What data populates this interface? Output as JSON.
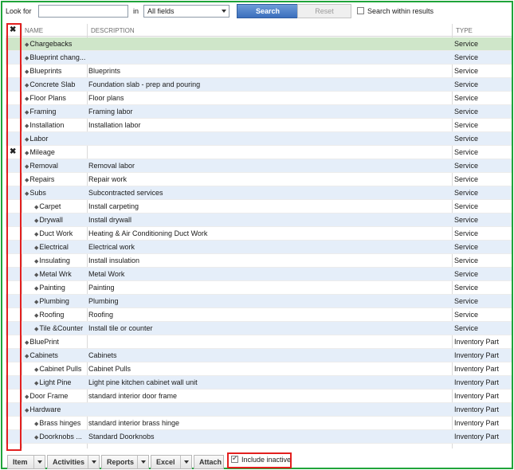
{
  "search": {
    "look_for_label": "Look for",
    "look_for_value": "",
    "in_label": "in",
    "field_selected": "All fields",
    "search_button": "Search",
    "reset_button": "Reset",
    "within_results_label": "Search within results"
  },
  "columns": {
    "active": "✖",
    "name": "NAME",
    "description": "DESCRIPTION",
    "type": "TYPE"
  },
  "items": [
    {
      "name": "Chargebacks",
      "description": "",
      "type": "Service",
      "indent": 0,
      "inactive": false
    },
    {
      "name": "Blueprint chang...",
      "description": "",
      "type": "Service",
      "indent": 0,
      "inactive": false
    },
    {
      "name": "Blueprints",
      "description": "Blueprints",
      "type": "Service",
      "indent": 0,
      "inactive": false
    },
    {
      "name": "Concrete Slab",
      "description": "Foundation slab - prep and pouring",
      "type": "Service",
      "indent": 0,
      "inactive": false
    },
    {
      "name": "Floor Plans",
      "description": "Floor plans",
      "type": "Service",
      "indent": 0,
      "inactive": false
    },
    {
      "name": "Framing",
      "description": "Framing labor",
      "type": "Service",
      "indent": 0,
      "inactive": false
    },
    {
      "name": "Installation",
      "description": "Installation labor",
      "type": "Service",
      "indent": 0,
      "inactive": false
    },
    {
      "name": "Labor",
      "description": "",
      "type": "Service",
      "indent": 0,
      "inactive": false
    },
    {
      "name": "Mileage",
      "description": "",
      "type": "Service",
      "indent": 0,
      "inactive": true
    },
    {
      "name": "Removal",
      "description": "Removal labor",
      "type": "Service",
      "indent": 0,
      "inactive": false
    },
    {
      "name": "Repairs",
      "description": "Repair work",
      "type": "Service",
      "indent": 0,
      "inactive": false
    },
    {
      "name": "Subs",
      "description": "Subcontracted services",
      "type": "Service",
      "indent": 0,
      "inactive": false
    },
    {
      "name": "Carpet",
      "description": "Install carpeting",
      "type": "Service",
      "indent": 1,
      "inactive": false
    },
    {
      "name": "Drywall",
      "description": "Install drywall",
      "type": "Service",
      "indent": 1,
      "inactive": false
    },
    {
      "name": "Duct Work",
      "description": "Heating & Air Conditioning Duct Work",
      "type": "Service",
      "indent": 1,
      "inactive": false
    },
    {
      "name": "Electrical",
      "description": "Electrical work",
      "type": "Service",
      "indent": 1,
      "inactive": false
    },
    {
      "name": "Insulating",
      "description": "Install insulation",
      "type": "Service",
      "indent": 1,
      "inactive": false
    },
    {
      "name": "Metal Wrk",
      "description": "Metal Work",
      "type": "Service",
      "indent": 1,
      "inactive": false
    },
    {
      "name": "Painting",
      "description": "Painting",
      "type": "Service",
      "indent": 1,
      "inactive": false
    },
    {
      "name": "Plumbing",
      "description": "Plumbing",
      "type": "Service",
      "indent": 1,
      "inactive": false
    },
    {
      "name": "Roofing",
      "description": "Roofing",
      "type": "Service",
      "indent": 1,
      "inactive": false
    },
    {
      "name": "Tile &Counter",
      "description": "Install tile or counter",
      "type": "Service",
      "indent": 1,
      "inactive": false
    },
    {
      "name": "BluePrint",
      "description": "",
      "type": "Inventory Part",
      "indent": 0,
      "inactive": false
    },
    {
      "name": "Cabinets",
      "description": "Cabinets",
      "type": "Inventory Part",
      "indent": 0,
      "inactive": false
    },
    {
      "name": "Cabinet Pulls",
      "description": "Cabinet Pulls",
      "type": "Inventory Part",
      "indent": 1,
      "inactive": false
    },
    {
      "name": "Light Pine",
      "description": "Light pine kitchen cabinet wall unit",
      "type": "Inventory Part",
      "indent": 1,
      "inactive": false
    },
    {
      "name": "Door Frame",
      "description": "standard interior door frame",
      "type": "Inventory Part",
      "indent": 0,
      "inactive": false
    },
    {
      "name": "Hardware",
      "description": "",
      "type": "Inventory Part",
      "indent": 0,
      "inactive": false
    },
    {
      "name": "Brass hinges",
      "description": "standard interior brass hinge",
      "type": "Inventory Part",
      "indent": 1,
      "inactive": false
    },
    {
      "name": "Doorknobs ...",
      "description": "Standard Doorknobs",
      "type": "Inventory Part",
      "indent": 1,
      "inactive": false
    }
  ],
  "footer": {
    "item": "Item",
    "activities": "Activities",
    "reports": "Reports",
    "excel": "Excel",
    "attach": "Attach",
    "include_inactive": "Include inactive",
    "include_inactive_checked": true
  },
  "colors": {
    "outer_frame": "#1fa43a",
    "highlight_box": "#e3201f",
    "selected_row": "#cfe6c9",
    "alt_row": "#e5eef9",
    "search_button": "#3b6fbd"
  }
}
